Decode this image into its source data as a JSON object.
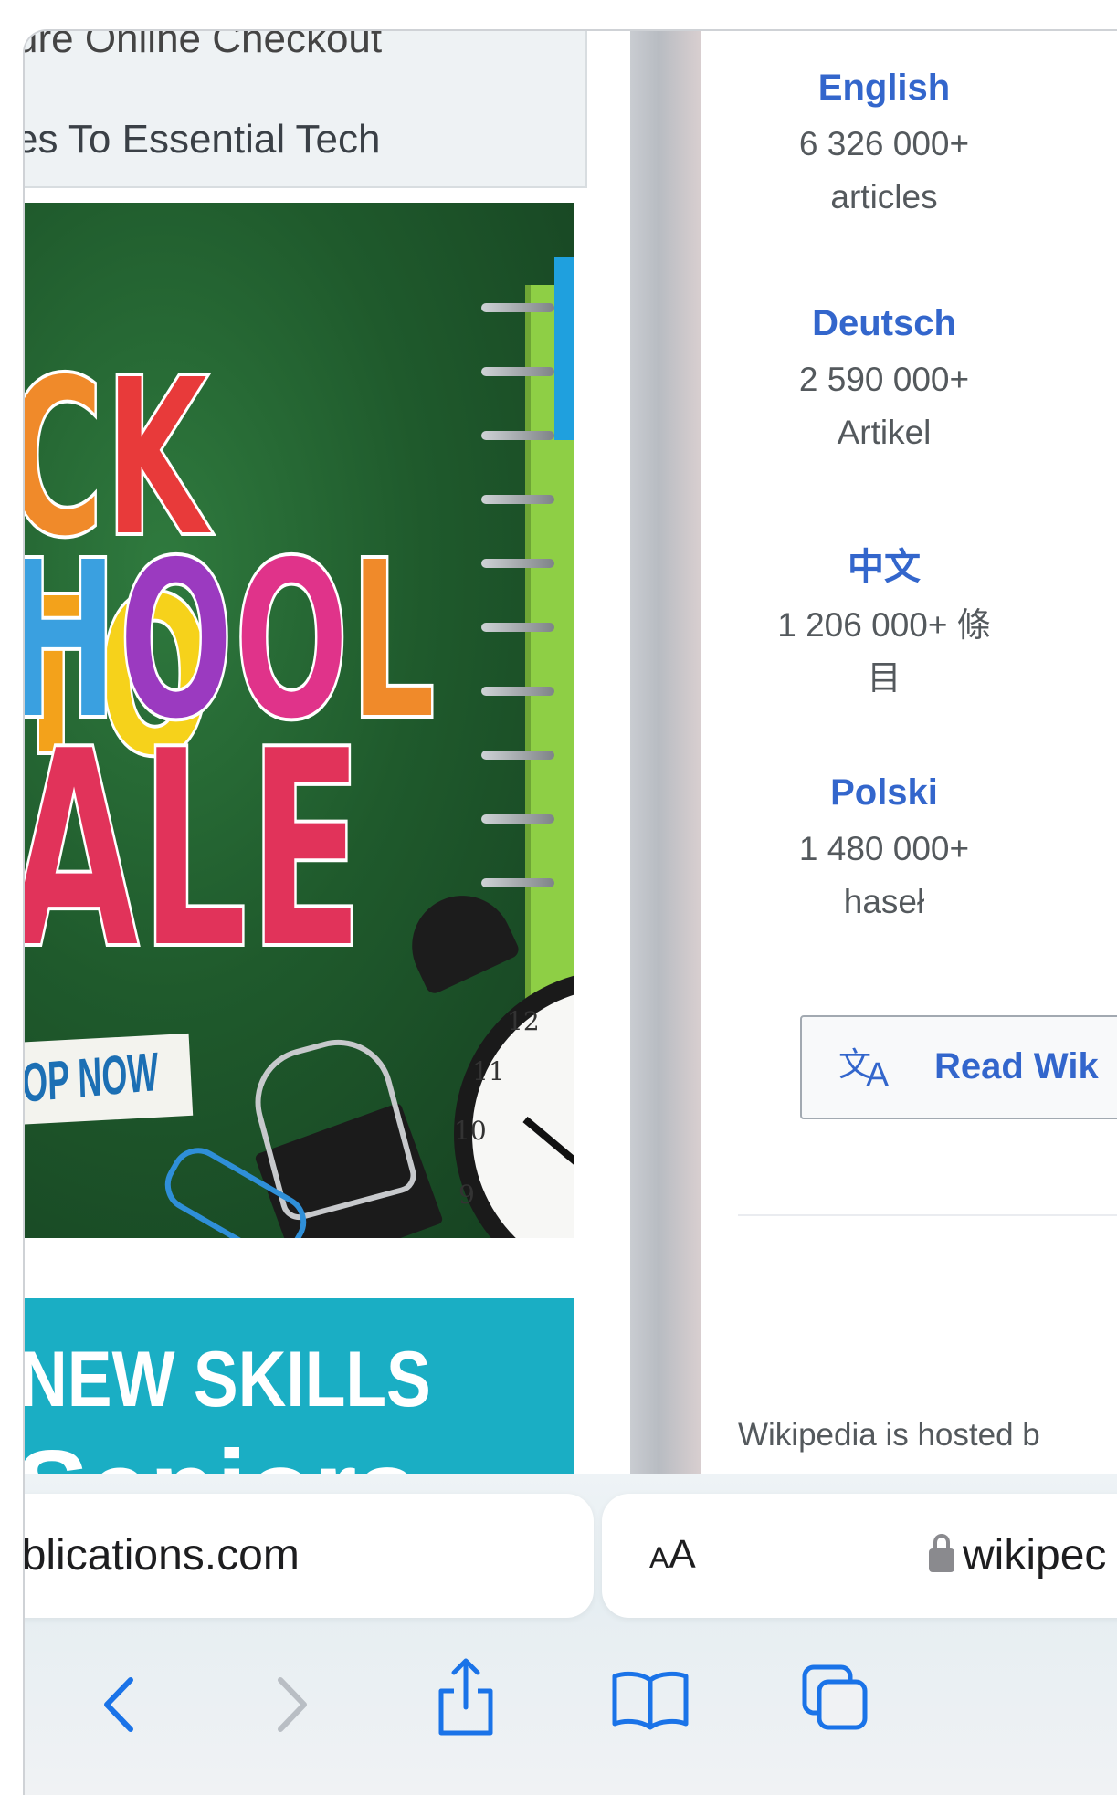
{
  "left_pane": {
    "nav_row_1": "ure Online Checkout",
    "nav_row_2": "es To Essential Tech",
    "banner": {
      "line1": "CK TO",
      "line2": "HOOL",
      "line3": "ALE",
      "shop_now": "OP NOW",
      "colors": {
        "green": "#1f5a2c",
        "red": "#e1335a"
      }
    },
    "skills_banner": {
      "line1": "NEW SKILLS",
      "line2": "Seniors"
    }
  },
  "wikipedia": {
    "languages": [
      {
        "name": "English",
        "count": "6 326 000+",
        "unit": "articles"
      },
      {
        "name": "Deutsch",
        "count": "2 590 000+",
        "unit": "Artikel"
      },
      {
        "name": "中文",
        "count": "1 206 000+ 條",
        "unit": "目"
      },
      {
        "name": "Polski",
        "count": "1 480 000+",
        "unit": "haseł"
      }
    ],
    "read_button_label": "Read Wik",
    "hosted_text": "Wikipedia is hosted b",
    "link_color": "#3366cc"
  },
  "toolbar": {
    "left_url": "ublications.com",
    "reader_label_small": "A",
    "reader_label_large": "A",
    "right_url": "wikipec",
    "icons": [
      "back-icon",
      "forward-icon",
      "share-icon",
      "bookmarks-icon",
      "tabs-icon"
    ]
  }
}
